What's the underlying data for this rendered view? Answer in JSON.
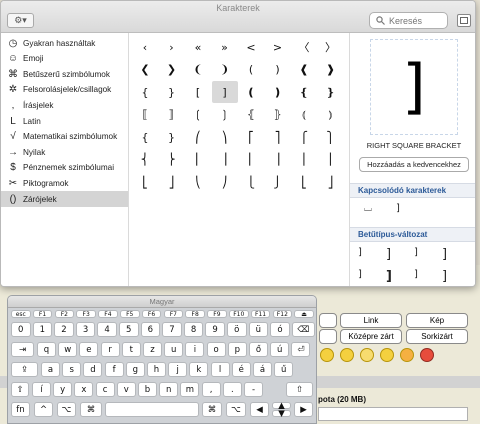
{
  "background": {
    "buttons_row1": [
      "Link",
      "Kép"
    ],
    "buttons_row2": [
      "Középre zárt",
      "Sorkizárt"
    ],
    "bottom_label": "pota (20 MB)",
    "emoticons": [
      "angel-smiley-icon",
      "happy-smiley-icon",
      "cool-smiley-icon",
      "party-smiley-icon",
      "devil-smiley-icon"
    ]
  },
  "window": {
    "title": "Karakterek",
    "search_placeholder": "Keresés",
    "gear_icon": "gear-icon",
    "expand_icon": "expand-window-icon"
  },
  "categories": [
    {
      "icon": "◷",
      "label": "Gyakran használtak"
    },
    {
      "icon": "☺",
      "label": "Emoji"
    },
    {
      "icon": "⌘",
      "label": "Betűszerű szimbólumok"
    },
    {
      "icon": "✲",
      "label": "Felsorolásjelek/csillagok"
    },
    {
      "icon": "‚",
      "label": "Írásjelek"
    },
    {
      "icon": "L",
      "label": "Latin"
    },
    {
      "icon": "√",
      "label": "Matematikai szimbólumok"
    },
    {
      "icon": "→",
      "label": "Nyilak"
    },
    {
      "icon": "$",
      "label": "Pénznemek szimbólumai"
    },
    {
      "icon": "✂",
      "label": "Piktogramok"
    },
    {
      "icon": "()",
      "label": "Zárójelek"
    }
  ],
  "selected_category": "Zárójelek",
  "grid_rows": [
    [
      "‹",
      "›",
      "«",
      "»",
      "<",
      ">",
      "〈",
      "〉"
    ],
    [
      "❮",
      "❯",
      "❨",
      "❩",
      "(",
      ")",
      "❰",
      "❱"
    ],
    [
      "{",
      "}",
      "[",
      "]",
      "❪",
      "❫",
      "❴",
      "❵"
    ],
    [
      "⟦",
      "⟧",
      "❲",
      "❳",
      "⦃",
      "⦄",
      "⦅",
      "⦆"
    ],
    [
      "{",
      "}",
      "⎛",
      "⎞",
      "⎡",
      "⎤",
      "⎧",
      "⎫"
    ],
    [
      "⎨",
      "⎬",
      "⎜",
      "⎟",
      "⎢",
      "⎥",
      "⎪",
      "⎪"
    ],
    [
      "⎣",
      "⎦",
      "⎝",
      "⎠",
      "⎩",
      "⎭",
      "⎣",
      "⎦"
    ]
  ],
  "detail": {
    "glyph": "]",
    "name": "RIGHT SQUARE BRACKET",
    "favorite_button": "Hozzáadás a kedvencekhez",
    "related_header": "Kapcsolódó karakterek",
    "related_chars": [
      "⌴",
      "]"
    ],
    "variants_header": "Betűtípus-változat",
    "variants": [
      "]",
      "]",
      "]",
      "]",
      "]",
      "]",
      "]",
      "]"
    ]
  },
  "keyboard": {
    "title": "Magyar",
    "fn_row": [
      "esc",
      "F1",
      "F2",
      "F3",
      "F4",
      "F5",
      "F6",
      "F7",
      "F8",
      "F9",
      "F10",
      "F11",
      "F12",
      "⏏"
    ],
    "number_row": [
      "0",
      "1",
      "2",
      "3",
      "4",
      "5",
      "6",
      "7",
      "8",
      "9",
      "ö",
      "ü",
      "ó",
      "⌫"
    ],
    "qwerty_row": [
      "⇥",
      "q",
      "w",
      "e",
      "r",
      "t",
      "z",
      "u",
      "i",
      "o",
      "p",
      "ő",
      "ú",
      "⏎"
    ],
    "home_row": [
      "⇪",
      "a",
      "s",
      "d",
      "f",
      "g",
      "h",
      "j",
      "k",
      "l",
      "é",
      "á",
      "ű"
    ],
    "shift_row": [
      "⇧",
      "í",
      "y",
      "x",
      "c",
      "v",
      "b",
      "n",
      "m",
      ",",
      ".",
      "-",
      "⇧"
    ],
    "bottom_row": [
      "fn",
      "^",
      "⌥",
      "⌘",
      "",
      "⌘",
      "⌥",
      "◀",
      "▲",
      "▼",
      "▶"
    ]
  }
}
